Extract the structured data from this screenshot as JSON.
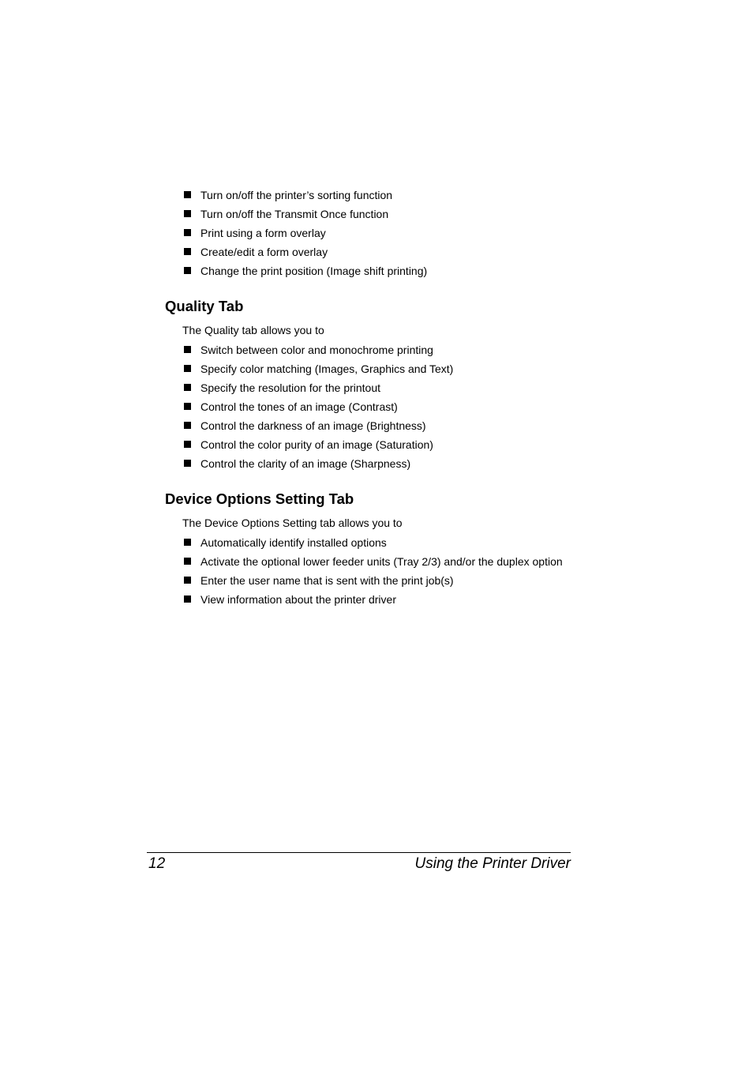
{
  "top_list": [
    "Turn on/off the printer’s sorting function",
    "Turn on/off the Transmit Once function",
    "Print using a form overlay",
    "Create/edit a form overlay",
    "Change the print position (Image shift printing)"
  ],
  "quality": {
    "heading": "Quality Tab",
    "intro": "The Quality tab allows you to",
    "items": [
      "Switch between color and monochrome printing",
      "Specify color matching (Images, Graphics and Text)",
      "Specify the resolution for the printout",
      "Control the tones of an image (Contrast)",
      "Control the darkness of an image (Brightness)",
      "Control the color purity of an image (Saturation)",
      "Control the clarity of an image (Sharpness)"
    ]
  },
  "device": {
    "heading": "Device Options Setting Tab",
    "intro": "The Device Options Setting tab allows you to",
    "items": [
      "Automatically identify installed options",
      "Activate the optional lower feeder units (Tray 2/3) and/or the duplex option",
      "Enter the user name that is sent with the print job(s)",
      "View information about the printer driver"
    ]
  },
  "footer": {
    "page_number": "12",
    "chapter_title": "Using the Printer Driver"
  }
}
